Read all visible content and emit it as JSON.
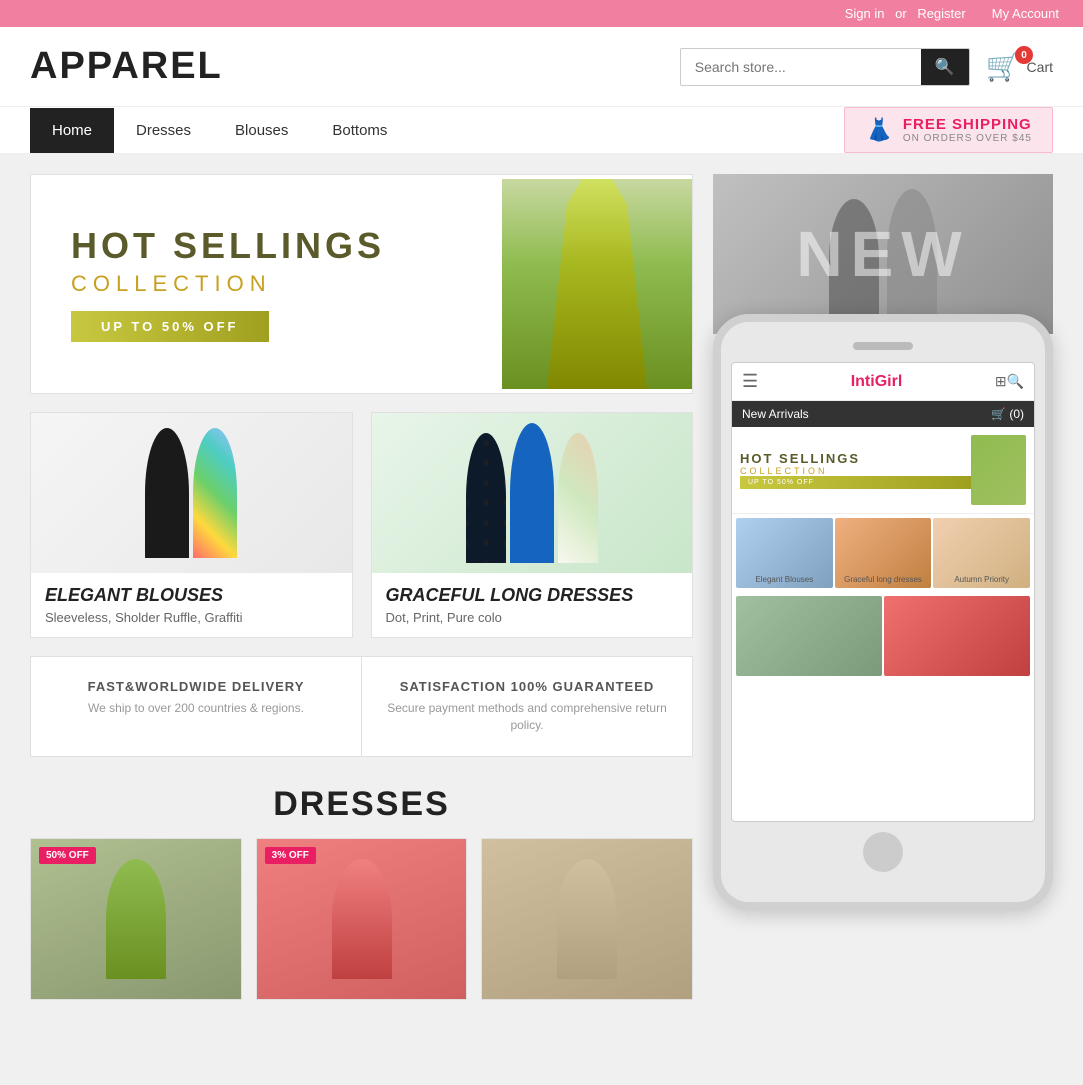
{
  "topbar": {
    "signin": "Sign in",
    "or": "or",
    "register": "Register",
    "myaccount": "My Account"
  },
  "header": {
    "logo": "APPAREL",
    "search_placeholder": "Search store...",
    "search_button_icon": "🔍",
    "cart_count": "0",
    "cart_label": "Cart"
  },
  "nav": {
    "items": [
      {
        "label": "Home",
        "active": true
      },
      {
        "label": "Dresses",
        "active": false
      },
      {
        "label": "Blouses",
        "active": false
      },
      {
        "label": "Bottoms",
        "active": false
      }
    ],
    "free_shipping_title": "FREE SHIPPING",
    "free_shipping_sub": "ON ORDERS OVER $45"
  },
  "hero": {
    "title": "HOT  SELLINGS",
    "subtitle": "COLLECTION",
    "cta": "UP TO 50% OFF"
  },
  "categories": [
    {
      "title": "ELEGANT BLOUSES",
      "desc": "Sleeveless, Sholder Ruffle, Graffiti"
    },
    {
      "title": "GRACEFUL LONG DRESSES",
      "desc": "Dot, Print, Pure colo"
    }
  ],
  "features": [
    {
      "title": "FAST&WORLDWIDE DELIVERY",
      "desc": "We ship to over 200 countries & regions."
    },
    {
      "title": "SATISFACTION 100% GUARANTEED",
      "desc": "Secure payment methods and comprehensive return policy."
    }
  ],
  "dresses_section": {
    "title": "DRESSES",
    "badges": [
      "50% OFF",
      "3% OFF",
      ""
    ]
  },
  "phone": {
    "brand": "Inti",
    "brand_accent": "Girl",
    "nav_label": "New Arrivals",
    "cart_label": "(0)",
    "hero_title": "HOT  SELLINGS",
    "hero_subtitle": "COLLECTION",
    "hero_cta": "UP TO 50% OFF",
    "cats": [
      "Elegant Blouses",
      "Graceful long dresses",
      "Autumn Priority"
    ]
  },
  "new_arrivals_banner": {
    "text": "NEW"
  }
}
